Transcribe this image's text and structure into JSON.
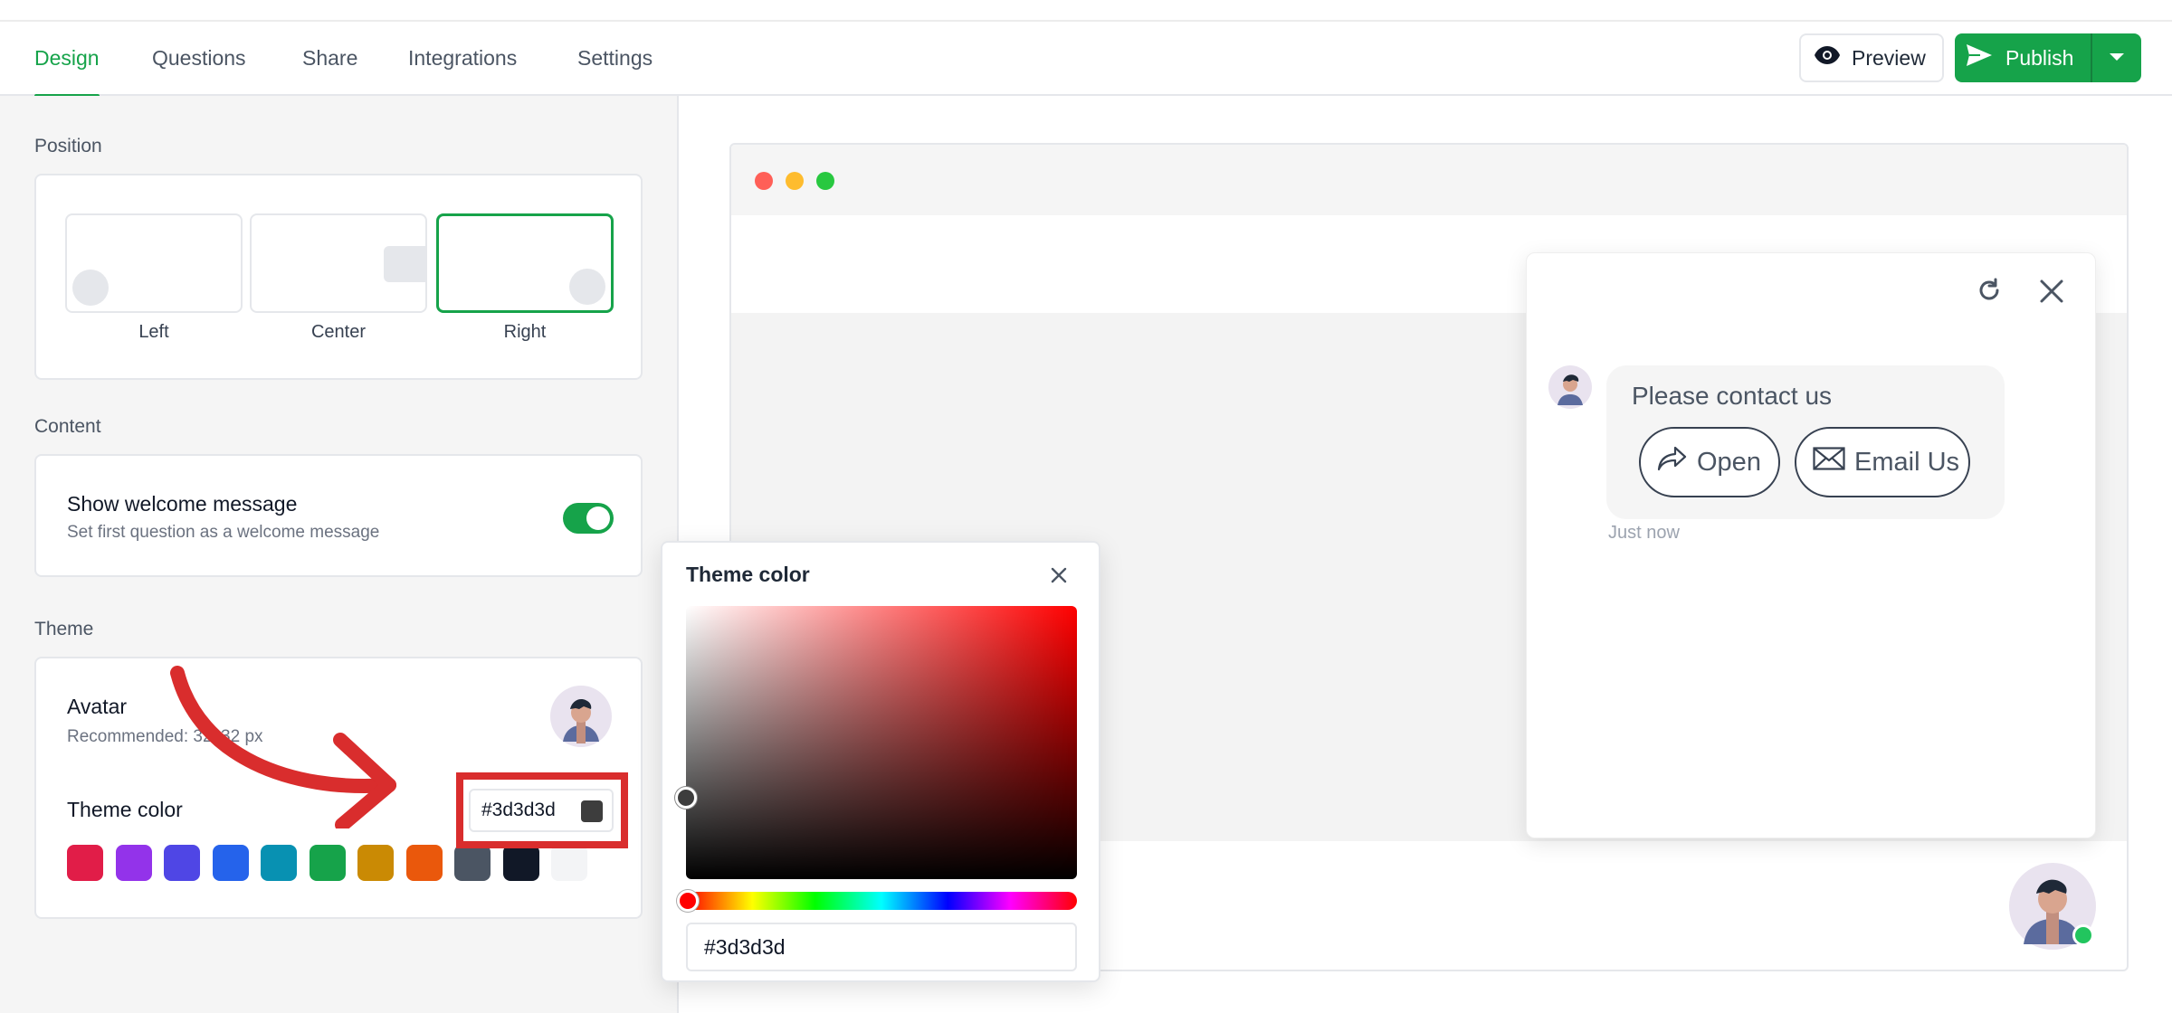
{
  "tabs": [
    {
      "label": "Design",
      "active": true
    },
    {
      "label": "Questions",
      "active": false
    },
    {
      "label": "Share",
      "active": false
    },
    {
      "label": "Integrations",
      "active": false
    },
    {
      "label": "Settings",
      "active": false
    }
  ],
  "actions": {
    "preview_label": "Preview",
    "publish_label": "Publish"
  },
  "position": {
    "section_label": "Position",
    "options": [
      "Left",
      "Center",
      "Right"
    ],
    "selected": "Right"
  },
  "content": {
    "section_label": "Content",
    "welcome_title": "Show welcome message",
    "welcome_desc": "Set first question as a welcome message",
    "welcome_enabled": true
  },
  "theme": {
    "section_label": "Theme",
    "avatar_title": "Avatar",
    "avatar_desc": "Recommended: 32x32 px",
    "color_label": "Theme color",
    "color_value": "#3d3d3d",
    "swatches": [
      "#e11d48",
      "#9333ea",
      "#4f46e5",
      "#2563eb",
      "#0891b2",
      "#16a34a",
      "#ca8a04",
      "#ea580c",
      "#4b5563",
      "#111827",
      "#f3f4f6"
    ]
  },
  "picker": {
    "title": "Theme color",
    "value": "#3d3d3d"
  },
  "chat_preview": {
    "message": "Please contact us",
    "buttons": [
      "Open",
      "Email Us"
    ],
    "timestamp": "Just now"
  },
  "colors": {
    "accent": "#16a34a",
    "annotation": "#d92d2d"
  }
}
